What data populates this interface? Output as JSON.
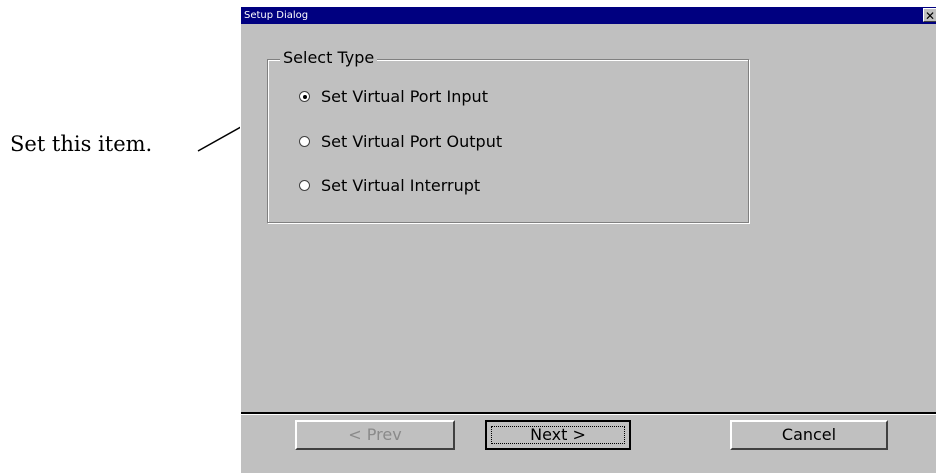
{
  "annotation": {
    "text": "Set this item."
  },
  "dialog": {
    "title": "Setup Dialog",
    "close_glyph": "✕",
    "group_label": "Select Type",
    "options": [
      {
        "label": "Set Virtual Port Input",
        "selected": true
      },
      {
        "label": "Set Virtual Port Output",
        "selected": false
      },
      {
        "label": "Set Virtual Interrupt",
        "selected": false
      }
    ],
    "buttons": {
      "prev": "< Prev",
      "next": "Next >",
      "cancel": "Cancel"
    }
  },
  "colors": {
    "titlebar": "#000080",
    "face": "#c0c0c0"
  }
}
